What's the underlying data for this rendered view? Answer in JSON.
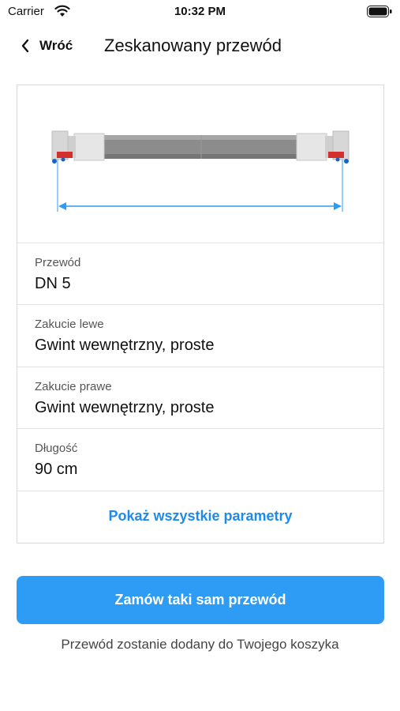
{
  "status_bar": {
    "carrier": "Carrier",
    "time": "10:32 PM"
  },
  "nav": {
    "back_label": "Wróć",
    "title": "Zeskanowany przewód"
  },
  "details": [
    {
      "label": "Przewód",
      "value": "DN 5"
    },
    {
      "label": "Zakucie lewe",
      "value": "Gwint wewnętrzny, proste"
    },
    {
      "label": "Zakucie prawe",
      "value": "Gwint wewnętrzny, proste"
    },
    {
      "label": "Długość",
      "value": "90 cm"
    }
  ],
  "show_all_label": "Pokaż wszystkie parametry",
  "order_button_label": "Zamów taki sam przewód",
  "info_text": "Przewód zostanie dodany do Twojego koszyka",
  "colors": {
    "accent": "#1e8bec",
    "button": "#2e9cf4",
    "hose": "#8c8c8c"
  }
}
